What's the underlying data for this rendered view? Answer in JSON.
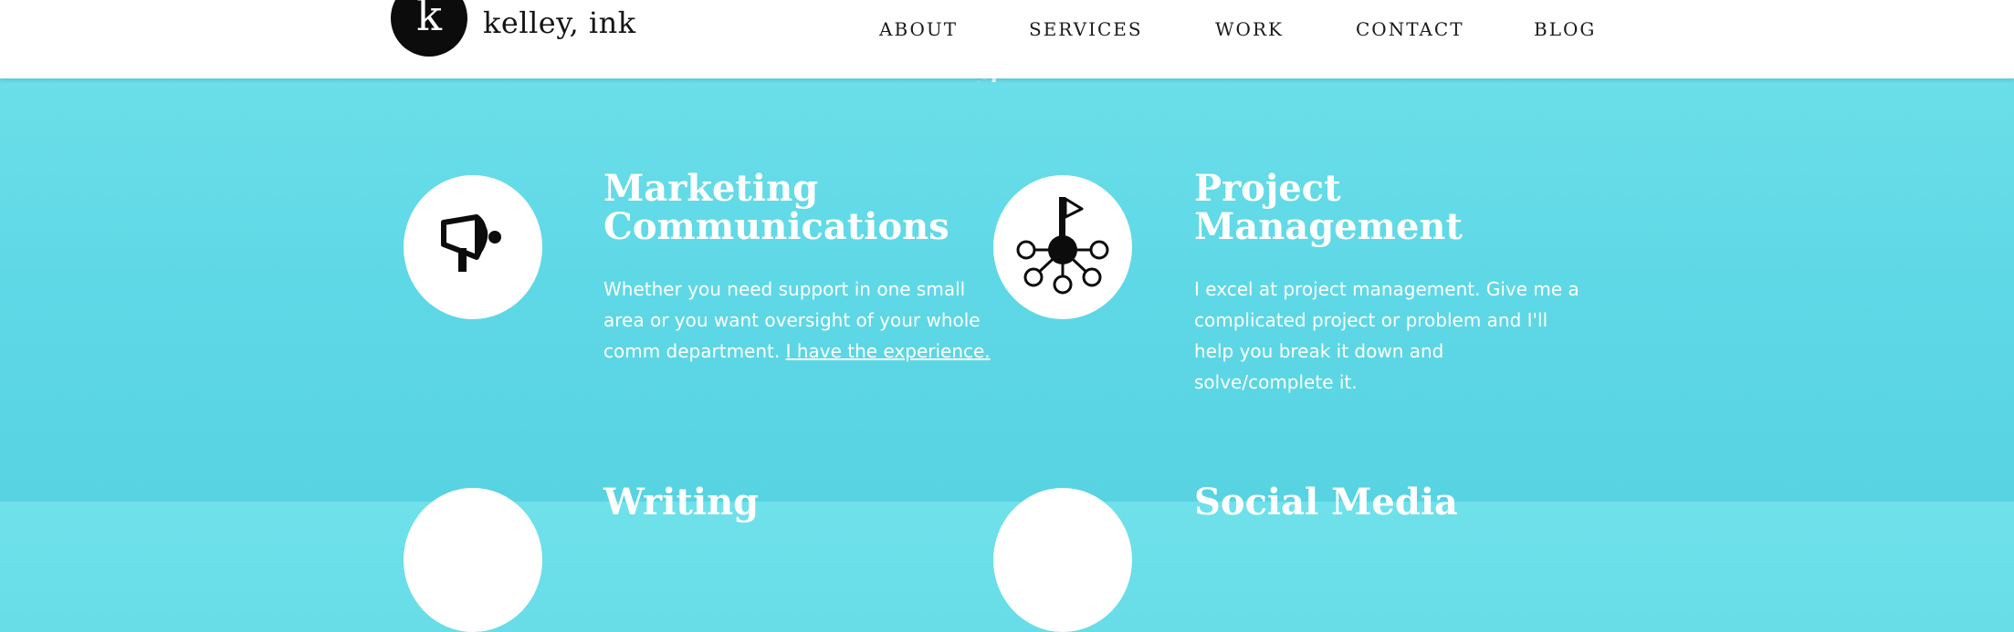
{
  "header": {
    "logo_letter": "k",
    "brand": "kelley, ink",
    "nav": [
      "ABOUT",
      "SERVICES",
      "WORK",
      "CONTACT",
      "BLOG"
    ]
  },
  "hero_peek": "g",
  "services": [
    {
      "title_line1": "Marketing",
      "title_line2": "Communications",
      "desc_line1": "Whether you need support in one small",
      "desc_line2": "area or you want oversight of your whole",
      "desc_line3": "comm department.",
      "link": "I have the experience.",
      "icon": "megaphone-icon"
    },
    {
      "title_line1": "Project",
      "title_line2": "Management",
      "desc_line1": "I excel at project management. Give me a",
      "desc_line2": "complicated project or problem and I'll",
      "desc_line3": "help you break it down and",
      "desc_line4": "solve/complete it.",
      "icon": "network-flag-icon"
    }
  ],
  "partial_services": [
    "Writing",
    "Social Media"
  ],
  "colors": {
    "background": "#5fd8e6",
    "header": "#ffffff",
    "text_dark": "#141414",
    "text_light": "#ffffff"
  }
}
